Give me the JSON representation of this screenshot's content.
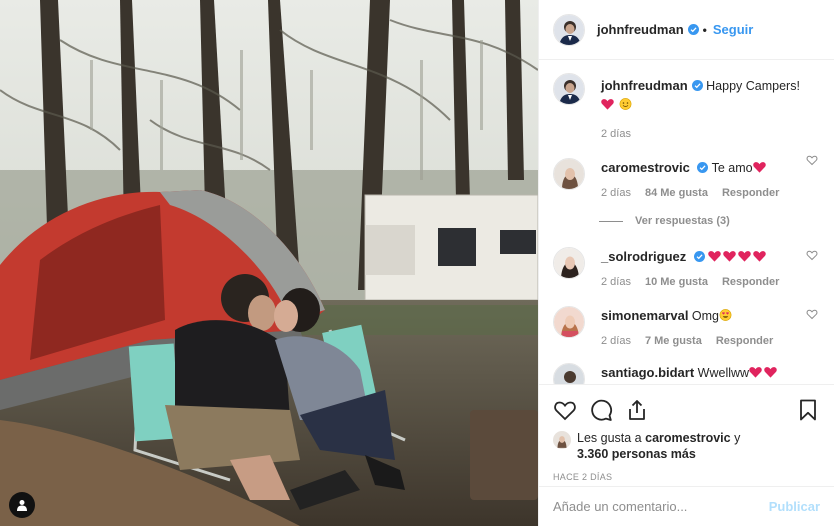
{
  "post": {
    "username": "johnfreudman",
    "follow_label": "Seguir",
    "caption": "Happy Campers!",
    "caption_age": "2 días"
  },
  "comments": [
    {
      "user": "caromestrovic",
      "text": "Te amo",
      "age": "2 días",
      "likes": "84 Me gusta",
      "reply": "Responder",
      "view_replies": "Ver respuestas (3)"
    },
    {
      "user": "_solrodriguez",
      "text": "",
      "age": "2 días",
      "likes": "10 Me gusta",
      "reply": "Responder"
    },
    {
      "user": "simonemarval",
      "text": "Omg",
      "age": "2 días",
      "likes": "7 Me gusta",
      "reply": "Responder"
    },
    {
      "user": "santiago.bidart",
      "text": "Wwellww"
    }
  ],
  "likes": {
    "prefix": "Les gusta a",
    "user": "caromestrovic",
    "middle": " y",
    "others": "3.360 personas más"
  },
  "post_age": "HACE 2 DÍAS",
  "add_comment": {
    "placeholder": "Añade un comentario...",
    "publish": "Publicar"
  },
  "colors": {
    "accent": "#3897f0",
    "verified": "#3897f0",
    "publish_disabled": "#b2dffc",
    "heart": "#e0245e"
  },
  "icons": [
    "verified-icon",
    "heart-icon",
    "comment-icon",
    "share-icon",
    "bookmark-icon",
    "user-tag-icon"
  ]
}
